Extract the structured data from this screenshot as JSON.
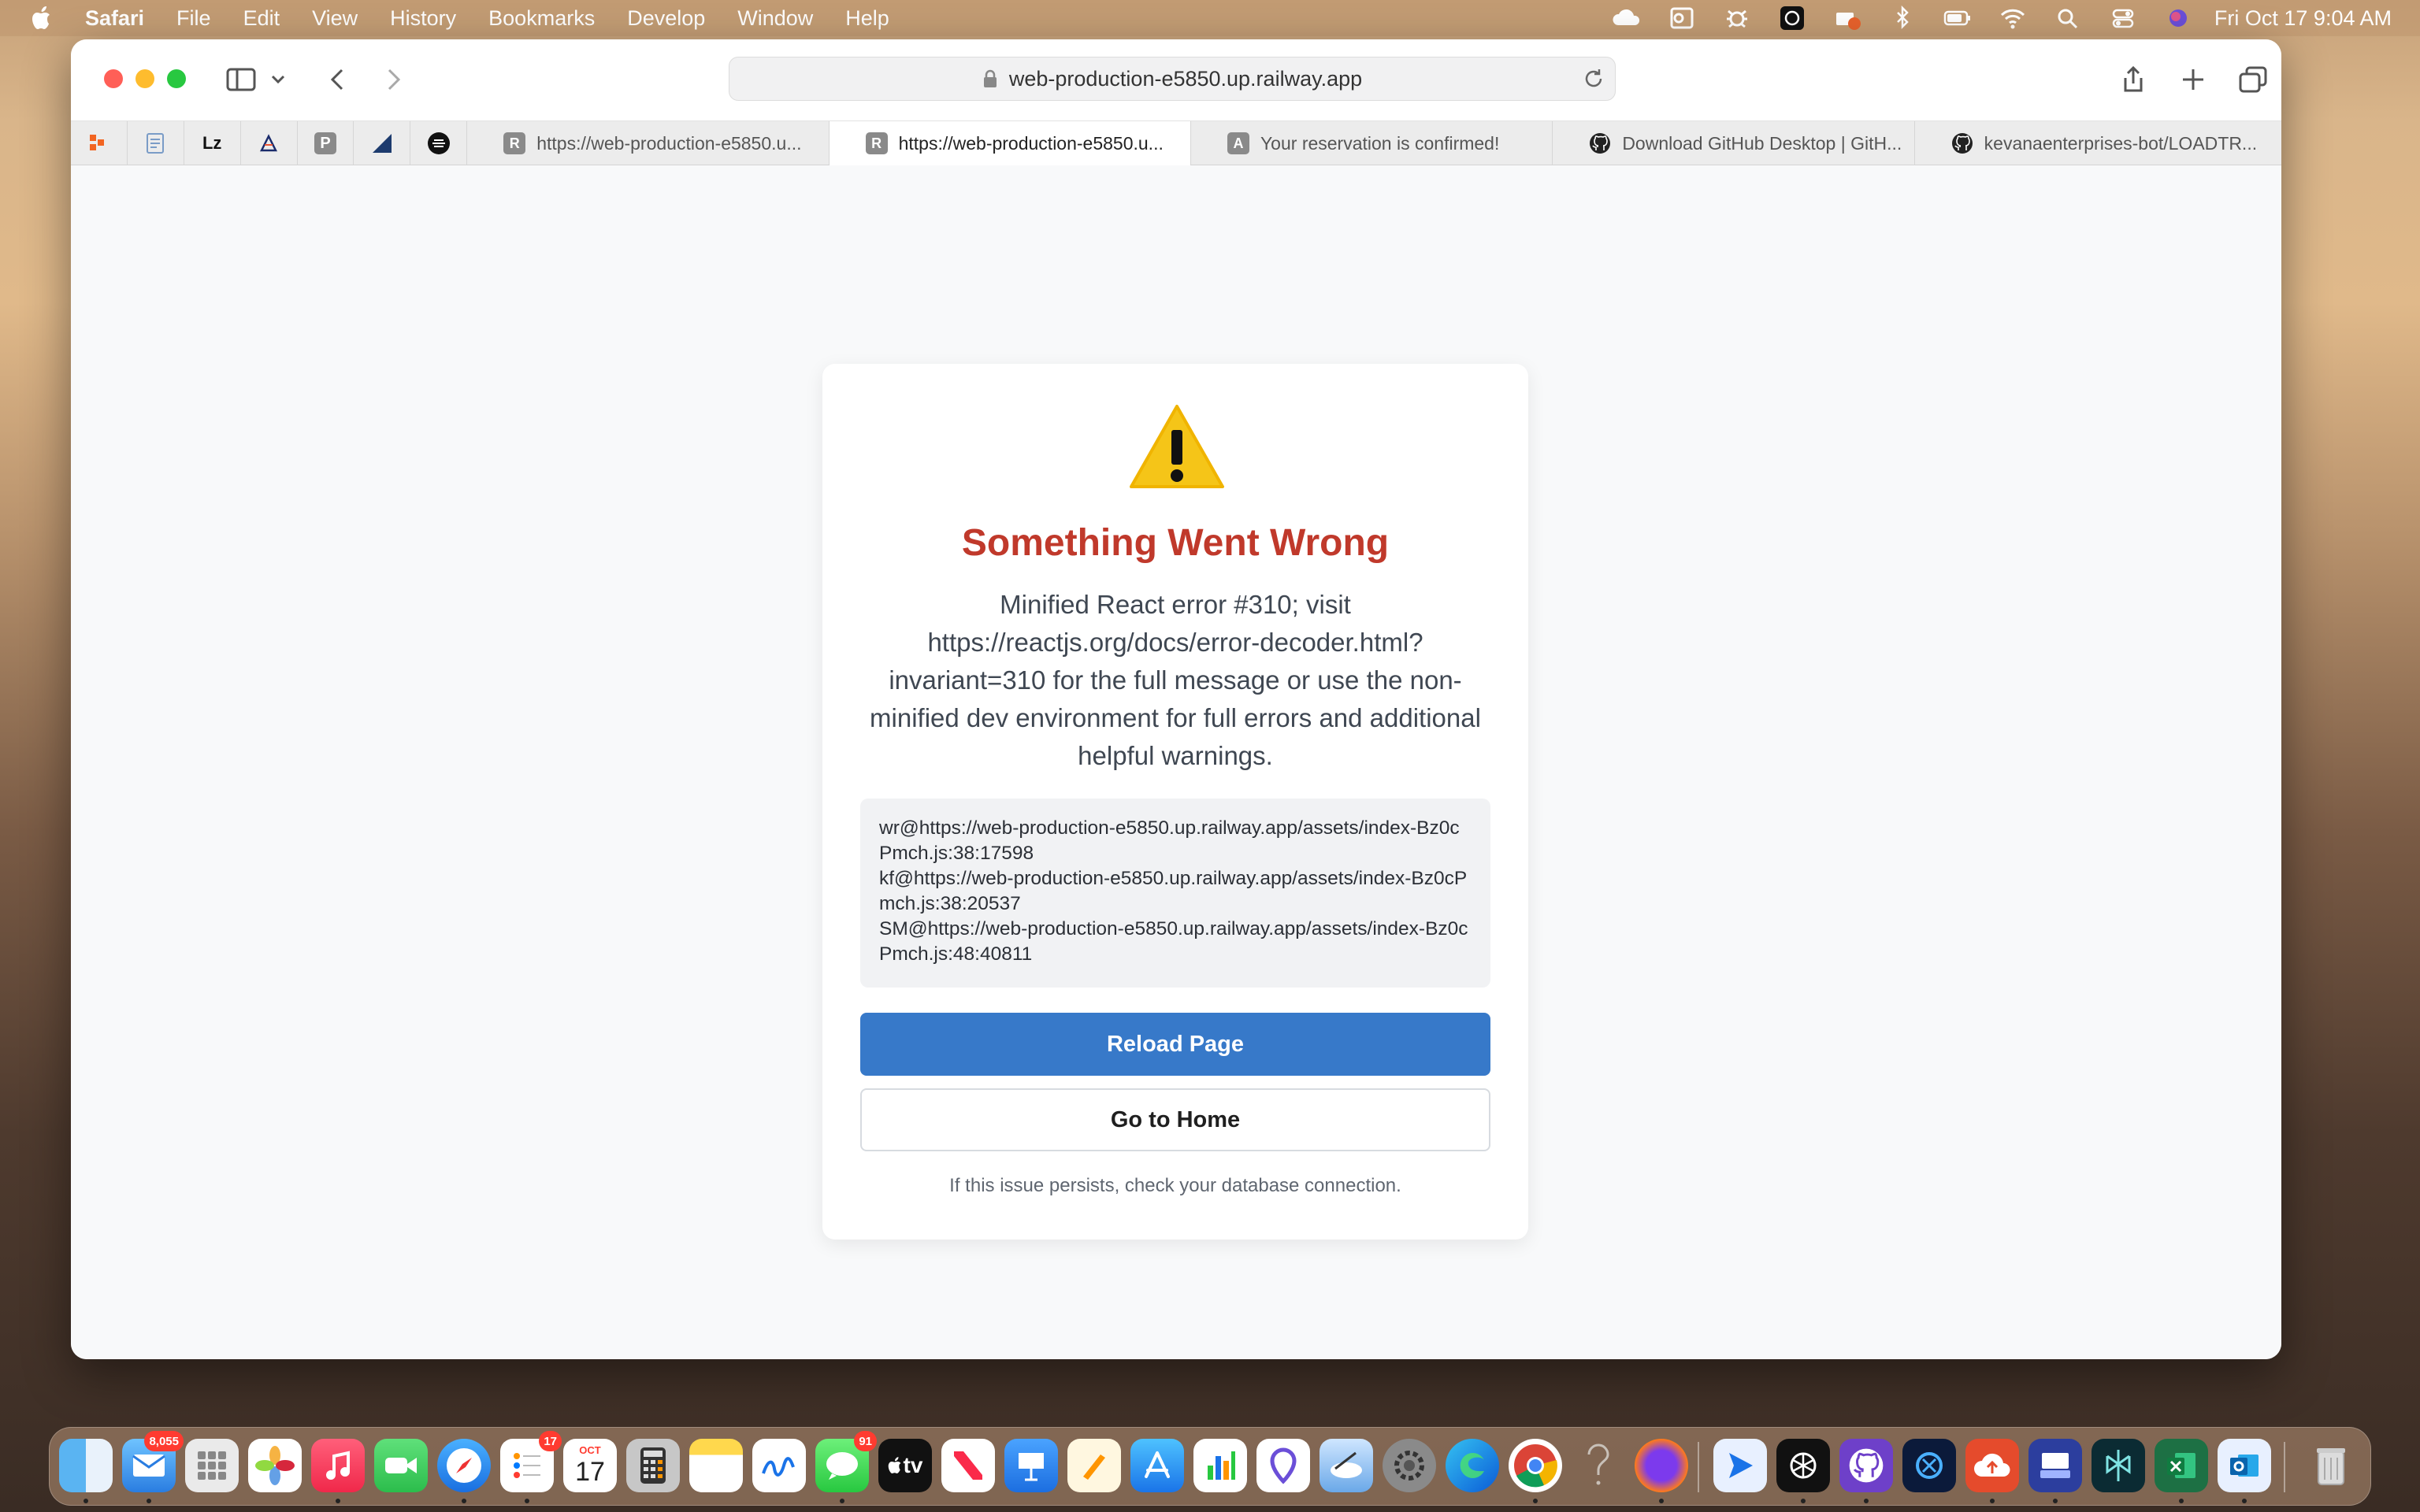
{
  "menubar": {
    "app": "Safari",
    "items": [
      "File",
      "Edit",
      "View",
      "History",
      "Bookmarks",
      "Develop",
      "Window",
      "Help"
    ],
    "clock": "Fri Oct 17  9:04 AM"
  },
  "browser": {
    "address": "web-production-e5850.up.railway.app",
    "tabs": [
      {
        "label": "https://web-production-e5850.u...",
        "icon_letter": "R",
        "active": false
      },
      {
        "label": "https://web-production-e5850.u...",
        "icon_letter": "R",
        "active": true
      },
      {
        "label": "Your reservation is confirmed!",
        "icon_letter": "A",
        "active": false
      },
      {
        "label": "Download GitHub Desktop | GitH...",
        "icon_letter": "github-icon",
        "active": false
      },
      {
        "label": "kevanaenterprises-bot/LOADTR...",
        "icon_letter": "github-icon",
        "active": false
      }
    ],
    "pinned_letters": [
      "",
      "",
      "Lz",
      "",
      "P",
      "",
      ""
    ]
  },
  "error_card": {
    "title": "Something Went Wrong",
    "message": "Minified React error #310; visit https://reactjs.org/docs/error-decoder.html?invariant=310 for the full message or use the non-minified dev environment for full errors and additional helpful warnings.",
    "trace": [
      "wr@https://web-production-e5850.up.railway.app/assets/index-Bz0cPmch.js:38:17598",
      "kf@https://web-production-e5850.up.railway.app/assets/index-Bz0cPmch.js:38:20537",
      "SM@https://web-production-e5850.up.railway.app/assets/index-Bz0cPmch.js:48:40811"
    ],
    "reload_label": "Reload Page",
    "home_label": "Go to Home",
    "footer": "If this issue persists, check your database connection."
  },
  "dock": {
    "mail_badge": "8,055",
    "reminders_badge": "17",
    "calendar_month": "OCT",
    "calendar_day": "17",
    "messages_badge": "91",
    "tv_label": "tv"
  },
  "colors": {
    "title_red": "#c0392b",
    "reload_blue": "#3779c9",
    "warning_yellow": "#f5c518"
  }
}
